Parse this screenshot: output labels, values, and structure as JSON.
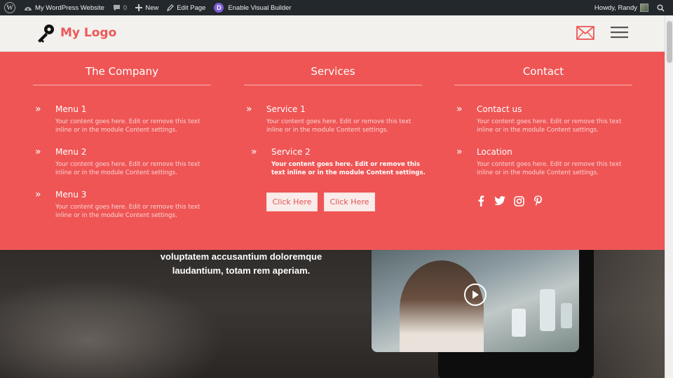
{
  "admin_bar": {
    "site_name": "My WordPress Website",
    "comments_count": "0",
    "new_label": "New",
    "edit_page_label": "Edit Page",
    "visual_builder_label": "Enable Visual Builder",
    "divi_letter": "D",
    "greeting": "Howdy, Randy"
  },
  "header": {
    "logo_text": "My Logo",
    "accent_color": "#ec5858"
  },
  "mega_menu": {
    "background": "#ef5555",
    "columns": [
      {
        "title": "The Company",
        "items": [
          {
            "title": "Menu 1",
            "desc": "Your content goes here. Edit or remove this text inline or in the module Content settings."
          },
          {
            "title": "Menu 2",
            "desc": "Your content goes here. Edit or remove this text inline or in the module Content settings."
          },
          {
            "title": "Menu 3",
            "desc": "Your content goes here. Edit or remove this text inline or in the module Content settings."
          }
        ]
      },
      {
        "title": "Services",
        "items": [
          {
            "title": "Service 1",
            "desc": "Your content goes here. Edit or remove this text inline or in the module Content settings."
          },
          {
            "title": "Service 2",
            "desc": "Your content goes here. Edit or remove this text inline or in the module Content settings."
          }
        ],
        "buttons": [
          "Click Here",
          "Click Here"
        ]
      },
      {
        "title": "Contact",
        "items": [
          {
            "title": "Contact us",
            "desc": "Your content goes here. Edit or remove this text inline or in the module Content settings."
          },
          {
            "title": "Location",
            "desc": "Your content goes here. Edit or remove this text inline or in the module Content settings."
          }
        ],
        "social_icons": [
          "facebook-icon",
          "twitter-icon",
          "instagram-icon",
          "pinterest-icon"
        ]
      }
    ]
  },
  "hero": {
    "text_line1": "voluptatem accusantium doloremque",
    "text_line2": "laudantium, totam rem aperiam."
  }
}
